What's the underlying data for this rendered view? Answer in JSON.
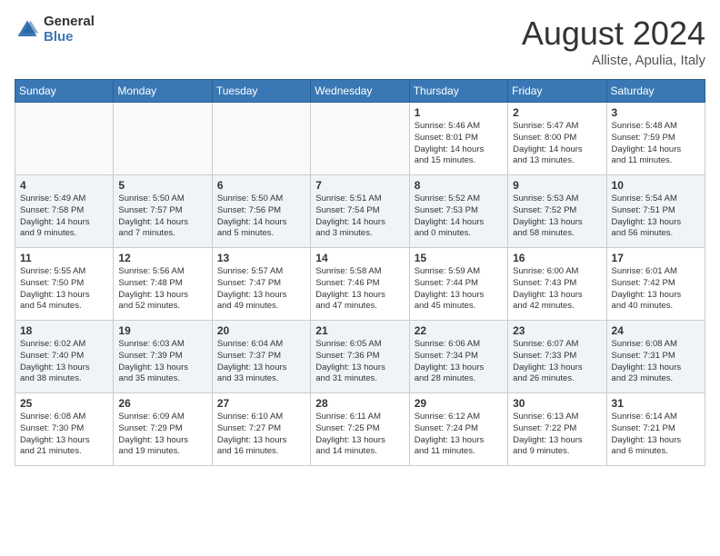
{
  "header": {
    "logo_general": "General",
    "logo_blue": "Blue",
    "month_title": "August 2024",
    "subtitle": "Alliste, Apulia, Italy"
  },
  "days_of_week": [
    "Sunday",
    "Monday",
    "Tuesday",
    "Wednesday",
    "Thursday",
    "Friday",
    "Saturday"
  ],
  "weeks": [
    [
      {
        "day": "",
        "detail": ""
      },
      {
        "day": "",
        "detail": ""
      },
      {
        "day": "",
        "detail": ""
      },
      {
        "day": "",
        "detail": ""
      },
      {
        "day": "1",
        "detail": "Sunrise: 5:46 AM\nSunset: 8:01 PM\nDaylight: 14 hours\nand 15 minutes."
      },
      {
        "day": "2",
        "detail": "Sunrise: 5:47 AM\nSunset: 8:00 PM\nDaylight: 14 hours\nand 13 minutes."
      },
      {
        "day": "3",
        "detail": "Sunrise: 5:48 AM\nSunset: 7:59 PM\nDaylight: 14 hours\nand 11 minutes."
      }
    ],
    [
      {
        "day": "4",
        "detail": "Sunrise: 5:49 AM\nSunset: 7:58 PM\nDaylight: 14 hours\nand 9 minutes."
      },
      {
        "day": "5",
        "detail": "Sunrise: 5:50 AM\nSunset: 7:57 PM\nDaylight: 14 hours\nand 7 minutes."
      },
      {
        "day": "6",
        "detail": "Sunrise: 5:50 AM\nSunset: 7:56 PM\nDaylight: 14 hours\nand 5 minutes."
      },
      {
        "day": "7",
        "detail": "Sunrise: 5:51 AM\nSunset: 7:54 PM\nDaylight: 14 hours\nand 3 minutes."
      },
      {
        "day": "8",
        "detail": "Sunrise: 5:52 AM\nSunset: 7:53 PM\nDaylight: 14 hours\nand 0 minutes."
      },
      {
        "day": "9",
        "detail": "Sunrise: 5:53 AM\nSunset: 7:52 PM\nDaylight: 13 hours\nand 58 minutes."
      },
      {
        "day": "10",
        "detail": "Sunrise: 5:54 AM\nSunset: 7:51 PM\nDaylight: 13 hours\nand 56 minutes."
      }
    ],
    [
      {
        "day": "11",
        "detail": "Sunrise: 5:55 AM\nSunset: 7:50 PM\nDaylight: 13 hours\nand 54 minutes."
      },
      {
        "day": "12",
        "detail": "Sunrise: 5:56 AM\nSunset: 7:48 PM\nDaylight: 13 hours\nand 52 minutes."
      },
      {
        "day": "13",
        "detail": "Sunrise: 5:57 AM\nSunset: 7:47 PM\nDaylight: 13 hours\nand 49 minutes."
      },
      {
        "day": "14",
        "detail": "Sunrise: 5:58 AM\nSunset: 7:46 PM\nDaylight: 13 hours\nand 47 minutes."
      },
      {
        "day": "15",
        "detail": "Sunrise: 5:59 AM\nSunset: 7:44 PM\nDaylight: 13 hours\nand 45 minutes."
      },
      {
        "day": "16",
        "detail": "Sunrise: 6:00 AM\nSunset: 7:43 PM\nDaylight: 13 hours\nand 42 minutes."
      },
      {
        "day": "17",
        "detail": "Sunrise: 6:01 AM\nSunset: 7:42 PM\nDaylight: 13 hours\nand 40 minutes."
      }
    ],
    [
      {
        "day": "18",
        "detail": "Sunrise: 6:02 AM\nSunset: 7:40 PM\nDaylight: 13 hours\nand 38 minutes."
      },
      {
        "day": "19",
        "detail": "Sunrise: 6:03 AM\nSunset: 7:39 PM\nDaylight: 13 hours\nand 35 minutes."
      },
      {
        "day": "20",
        "detail": "Sunrise: 6:04 AM\nSunset: 7:37 PM\nDaylight: 13 hours\nand 33 minutes."
      },
      {
        "day": "21",
        "detail": "Sunrise: 6:05 AM\nSunset: 7:36 PM\nDaylight: 13 hours\nand 31 minutes."
      },
      {
        "day": "22",
        "detail": "Sunrise: 6:06 AM\nSunset: 7:34 PM\nDaylight: 13 hours\nand 28 minutes."
      },
      {
        "day": "23",
        "detail": "Sunrise: 6:07 AM\nSunset: 7:33 PM\nDaylight: 13 hours\nand 26 minutes."
      },
      {
        "day": "24",
        "detail": "Sunrise: 6:08 AM\nSunset: 7:31 PM\nDaylight: 13 hours\nand 23 minutes."
      }
    ],
    [
      {
        "day": "25",
        "detail": "Sunrise: 6:08 AM\nSunset: 7:30 PM\nDaylight: 13 hours\nand 21 minutes."
      },
      {
        "day": "26",
        "detail": "Sunrise: 6:09 AM\nSunset: 7:29 PM\nDaylight: 13 hours\nand 19 minutes."
      },
      {
        "day": "27",
        "detail": "Sunrise: 6:10 AM\nSunset: 7:27 PM\nDaylight: 13 hours\nand 16 minutes."
      },
      {
        "day": "28",
        "detail": "Sunrise: 6:11 AM\nSunset: 7:25 PM\nDaylight: 13 hours\nand 14 minutes."
      },
      {
        "day": "29",
        "detail": "Sunrise: 6:12 AM\nSunset: 7:24 PM\nDaylight: 13 hours\nand 11 minutes."
      },
      {
        "day": "30",
        "detail": "Sunrise: 6:13 AM\nSunset: 7:22 PM\nDaylight: 13 hours\nand 9 minutes."
      },
      {
        "day": "31",
        "detail": "Sunrise: 6:14 AM\nSunset: 7:21 PM\nDaylight: 13 hours\nand 6 minutes."
      }
    ]
  ]
}
